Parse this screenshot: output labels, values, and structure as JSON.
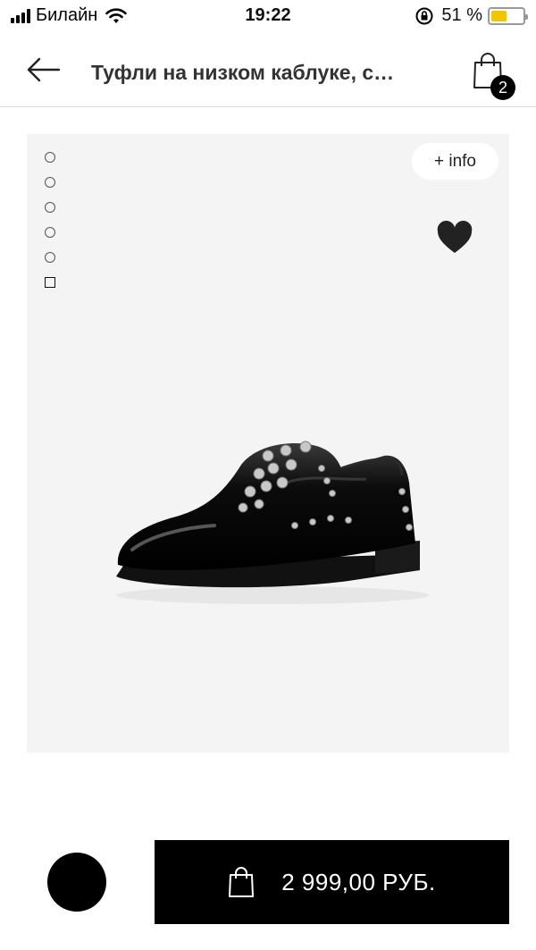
{
  "status_bar": {
    "carrier": "Билайн",
    "time": "19:22",
    "battery_percent": "51 %",
    "battery_level": 0.51,
    "battery_color": "#f4c400"
  },
  "header": {
    "title": "Туфли на низком каблуке, с…",
    "cart_count": "2",
    "back_icon": "arrow-left-icon",
    "cart_icon": "shopping-bag-icon"
  },
  "gallery": {
    "image_count": 6,
    "active_index": 5,
    "info_label": "+ info",
    "favorite_icon": "heart-icon",
    "image": "black-studded-oxford-shoe"
  },
  "purchase": {
    "selected_color": "#000000",
    "price_label": "2 999,00  РУБ.",
    "bag_icon": "shopping-bag-icon"
  }
}
